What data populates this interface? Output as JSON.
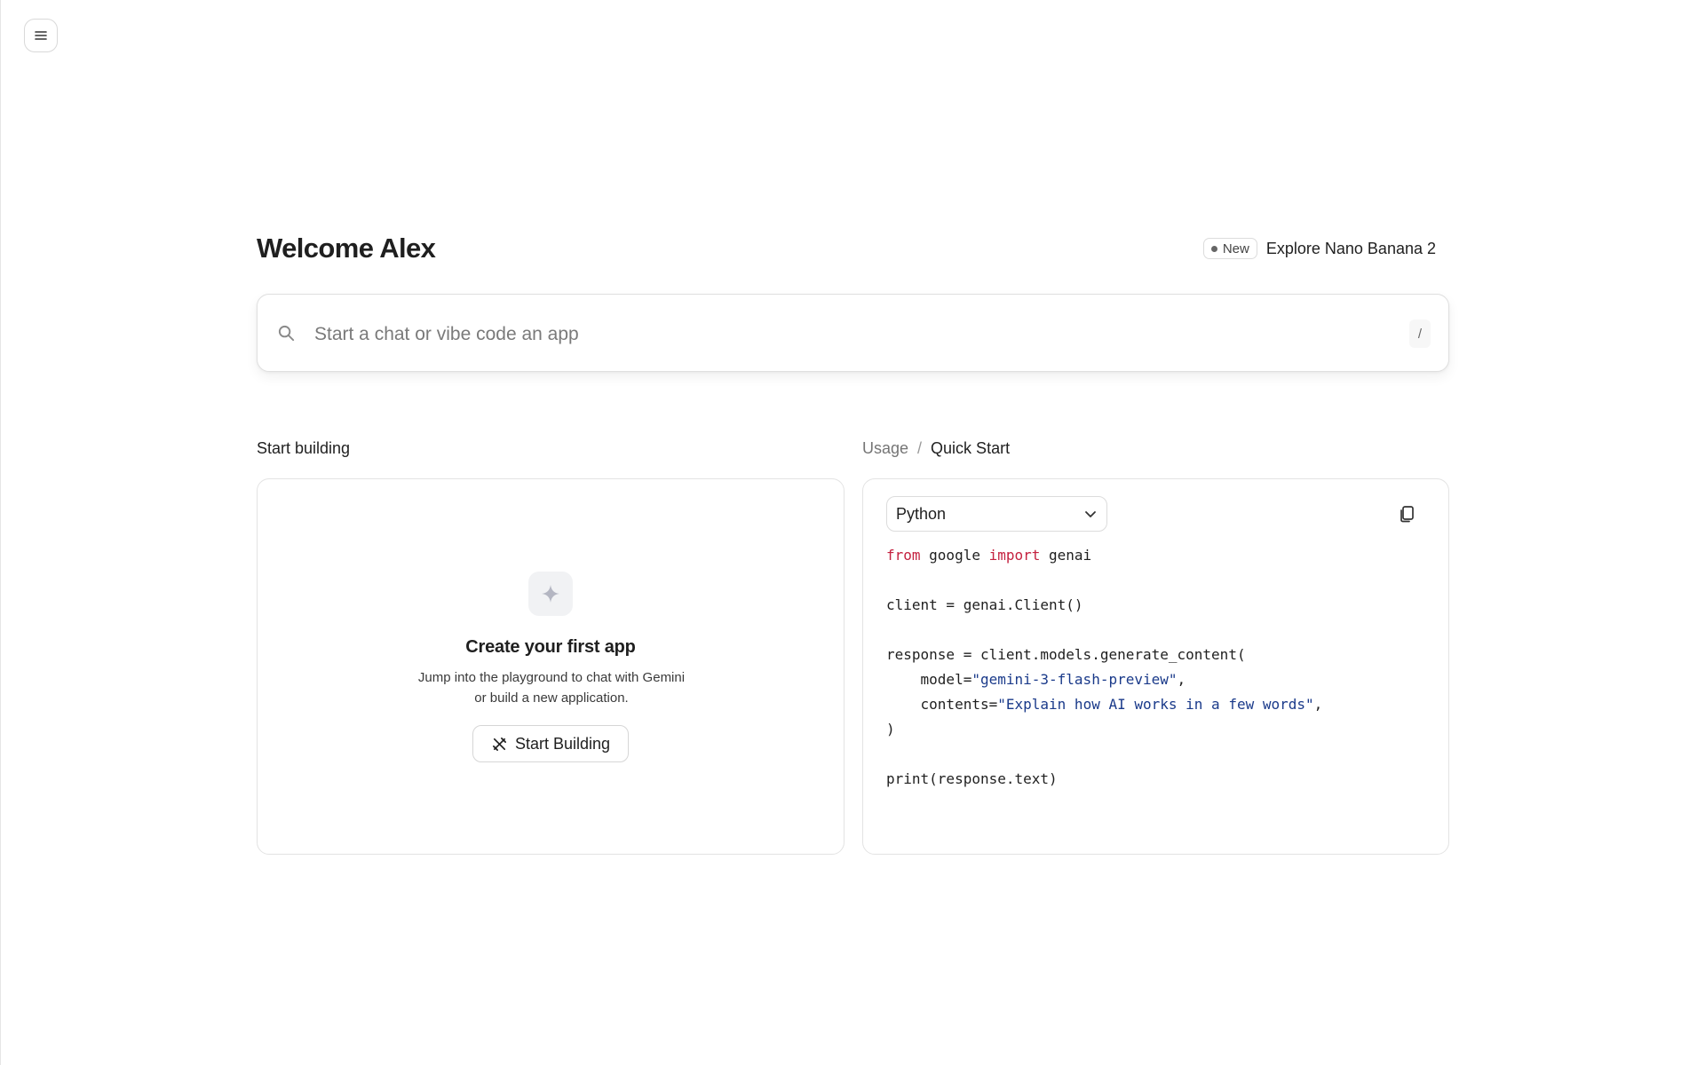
{
  "header": {
    "menu_icon": "hamburger-menu-icon"
  },
  "welcome": {
    "title": "Welcome Alex"
  },
  "promo": {
    "badge": "New",
    "link": "Explore Nano Banana 2"
  },
  "search": {
    "placeholder": "Start a chat or vibe code an app",
    "value": "",
    "shortcut": "/",
    "icon": "search-icon"
  },
  "start_building": {
    "section_label": "Start building",
    "card_title": "Create your first app",
    "card_description": "Jump into the playground to chat with Gemini or build a new application.",
    "button_label": "Start Building",
    "icon": "sparkle-icon",
    "button_icon": "build-tools-icon"
  },
  "quick_start": {
    "breadcrumb": {
      "parent": "Usage",
      "separator": "/",
      "current": "Quick Start"
    },
    "language": "Python",
    "copy_icon": "copy-icon",
    "code": {
      "line1": {
        "kw1": "from",
        "mid": " google ",
        "kw2": "import",
        "rest": " genai"
      },
      "line2": "client = genai.Client()",
      "line3": "response = client.models.generate_content(",
      "line4": {
        "pre": "    model=",
        "str": "\"gemini-3-flash-preview\"",
        "post": ","
      },
      "line5": {
        "pre": "    contents=",
        "str": "\"Explain how AI works in a few words\"",
        "post": ","
      },
      "line6": ")",
      "line7": "print(response.text)"
    }
  },
  "colors": {
    "keyword": "#c4213f",
    "string": "#1a3a8a",
    "border": "#e3e3e3",
    "text": "#1f1f1f"
  }
}
